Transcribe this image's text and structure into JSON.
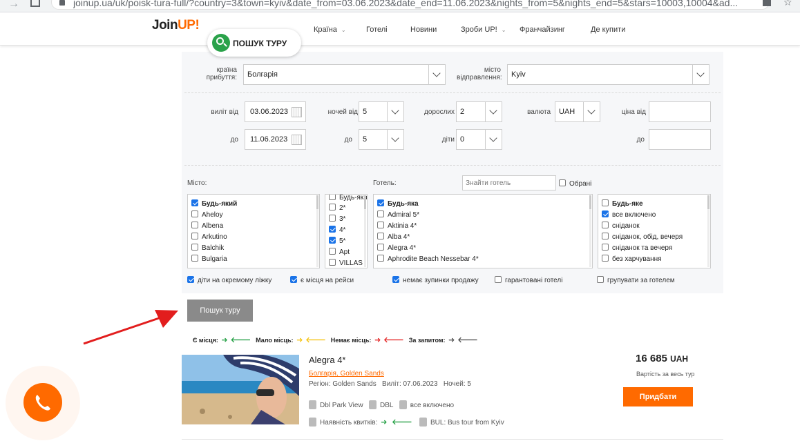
{
  "browser": {
    "url": "joinup.ua/uk/poisk-tura-full/?country=3&town=kyiv&date_from=03.06.2023&date_end=11.06.2023&nights_from=5&nights_end=5&stars=10003,10004&ad..."
  },
  "header": {
    "logo": "Join",
    "logo_accent": "UP!",
    "nav": [
      "Країна",
      "Готелі",
      "Новини",
      "Зроби UP!",
      "Франчайзинг",
      "Де купити"
    ],
    "search_tab": "ПОШУК ТУРУ"
  },
  "form": {
    "country_label": "країна прибуття:",
    "country_value": "Болгарія",
    "city_from_label": "місто відправлення:",
    "city_from_value": "Kyiv",
    "depart_from_label": "виліт від",
    "depart_from_value": "03.06.2023",
    "depart_to_label": "до",
    "depart_to_value": "11.06.2023",
    "nights_from_label": "ночей від",
    "nights_from_value": "5",
    "nights_to_label": "до",
    "nights_to_value": "5",
    "adults_label": "дорослих",
    "adults_value": "2",
    "children_label": "діти",
    "children_value": "0",
    "currency_label": "валюта",
    "currency_value": "UAH",
    "price_from_label": "ціна від",
    "price_to_label": "до",
    "city_list_label": "Місто:",
    "hotel_list_label": "Готель:",
    "hotel_search_placeholder": "Знайти готель",
    "favorites_label": "Обрані",
    "cities": [
      {
        "label": "Будь-який",
        "checked": true
      },
      {
        "label": "Aheloy",
        "checked": false
      },
      {
        "label": "Albena",
        "checked": false
      },
      {
        "label": "Arkutino",
        "checked": false
      },
      {
        "label": "Balchik",
        "checked": false
      },
      {
        "label": "Bulgaria",
        "checked": false
      }
    ],
    "stars": [
      {
        "label": "Будь-яка",
        "checked": false
      },
      {
        "label": "2*",
        "checked": false
      },
      {
        "label": "3*",
        "checked": false
      },
      {
        "label": "4*",
        "checked": true
      },
      {
        "label": "5*",
        "checked": true
      },
      {
        "label": "Apt",
        "checked": false
      },
      {
        "label": "VILLAS",
        "checked": false
      }
    ],
    "hotels": [
      {
        "label": "Будь-яка",
        "checked": true
      },
      {
        "label": "Admiral 5*",
        "checked": false
      },
      {
        "label": "Aktinia 4*",
        "checked": false
      },
      {
        "label": "Alba 4*",
        "checked": false
      },
      {
        "label": "Alegra 4*",
        "checked": false
      },
      {
        "label": "Aphrodite Beach Nessebar 4*",
        "checked": false
      }
    ],
    "meals": [
      {
        "label": "Будь-яке",
        "checked": false
      },
      {
        "label": "все включено",
        "checked": true
      },
      {
        "label": "сніданок",
        "checked": false
      },
      {
        "label": "сніданок, обід, вечеря",
        "checked": false
      },
      {
        "label": "сніданок та вечеря",
        "checked": false
      },
      {
        "label": "без харчування",
        "checked": false
      }
    ],
    "options": [
      {
        "label": "діти на окремому ліжку",
        "checked": true
      },
      {
        "label": "є місця на рейси",
        "checked": true
      },
      {
        "label": "немає зупинки продажу",
        "checked": true
      },
      {
        "label": "гарантовані готелі",
        "checked": false
      },
      {
        "label": "групувати за готелем",
        "checked": false
      }
    ],
    "submit": "Пошук туру"
  },
  "legend": {
    "available": "Є місця:",
    "few": "Мало місць:",
    "none": "Немає місць:",
    "request": "За запитом:",
    "colors": {
      "available": "#2aa24a",
      "few": "#f5c518",
      "none": "#e52a2a",
      "request": "#555555"
    }
  },
  "result": {
    "name": "Alegra 4*",
    "location": "Болгарія, Golden Sands",
    "region_label": "Регіон:",
    "region": "Golden Sands",
    "depart_label": "Виліт:",
    "depart": "07.06.2023",
    "nights_label": "Ночей:",
    "nights": "5",
    "room": "Dbl Park View",
    "accommodation": "DBL",
    "meal": "все включено",
    "tickets_label": "Наявність квитків:",
    "transport": "BUL: Bus tour from Kyiv",
    "price": "16 685",
    "currency": "UAH",
    "price_note": "Вартість за весь тур",
    "buy": "Придбати"
  },
  "colors": {
    "accent": "#ff6a00",
    "green": "#2aa24a",
    "button_gray": "#8a8a8a"
  }
}
